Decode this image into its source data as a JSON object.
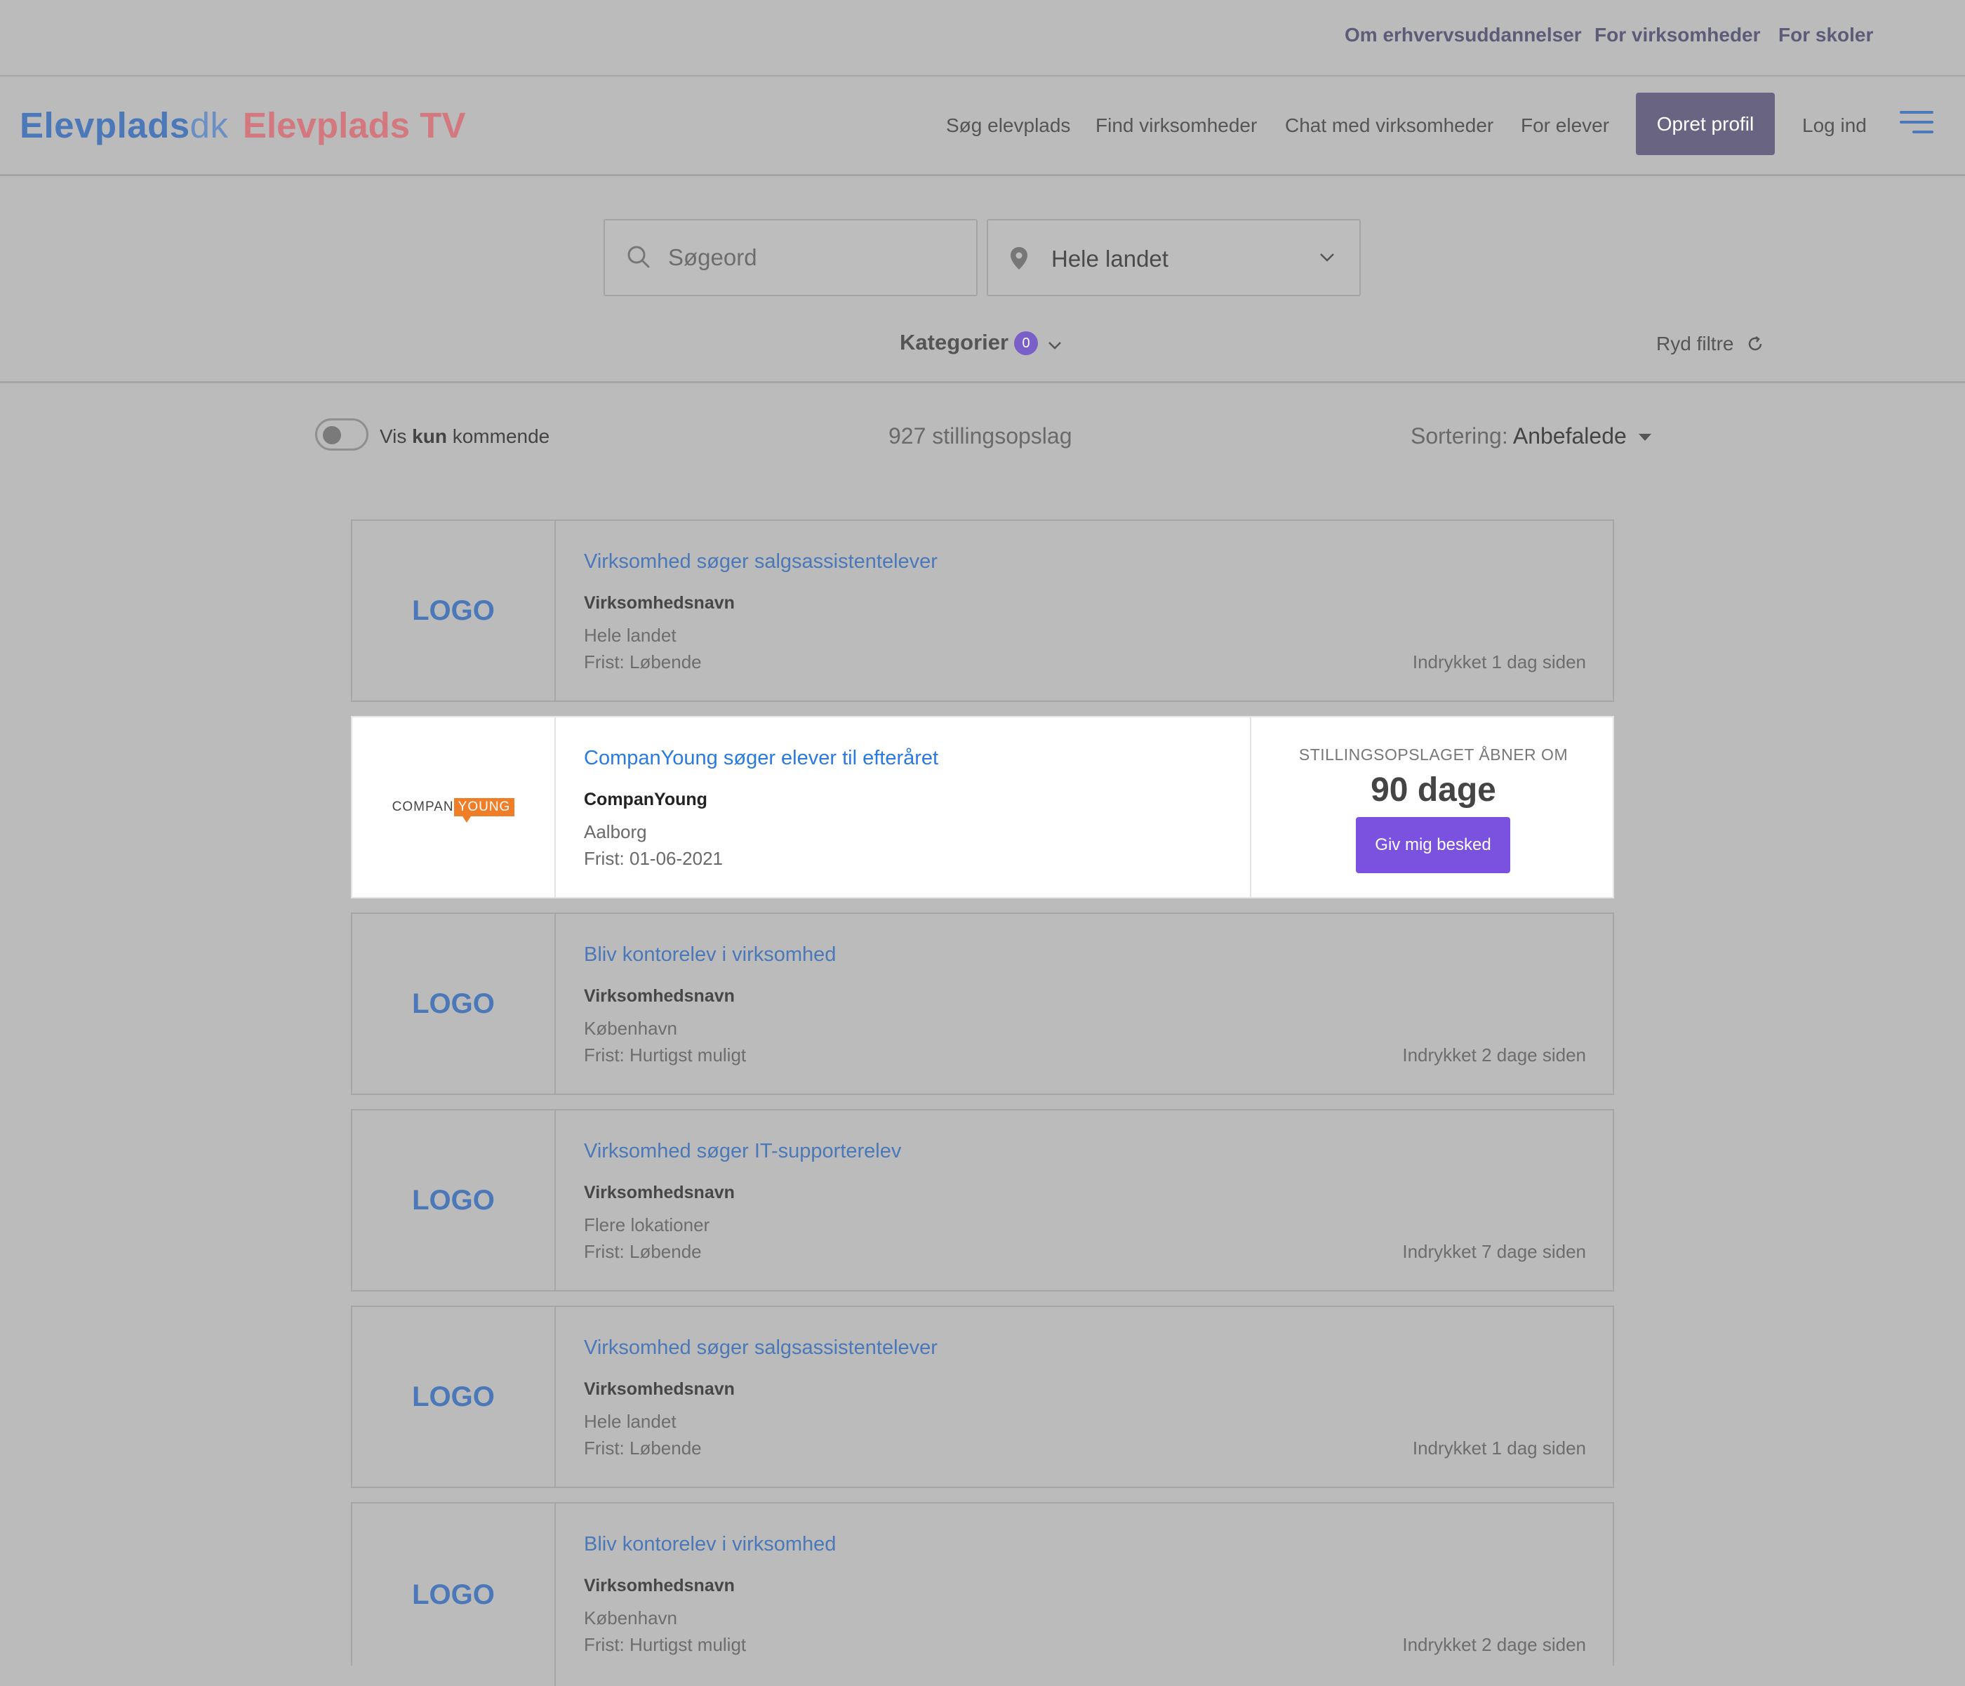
{
  "topbar": {
    "links": [
      "Om erhvervsuddannelser",
      "For virksomheder",
      "For skoler"
    ]
  },
  "header": {
    "logo": {
      "main": "Elevplads",
      "suffix": "dk"
    },
    "logo_tv": "Elevplads TV",
    "nav": [
      "Søg elevplads",
      "Find virksomheder",
      "Chat med virksomheder",
      "For elever"
    ],
    "cta": "Opret profil",
    "login": "Log ind"
  },
  "search": {
    "keyword_placeholder": "Søgeord",
    "location_value": "Hele landet"
  },
  "filters": {
    "categories_label": "Kategorier",
    "categories_count": "0",
    "clear_label": "Ryd filtre"
  },
  "toolbar": {
    "toggle_label": {
      "pre": "Vis",
      "bold": "kun",
      "post": "kommende"
    },
    "count_text": "927 stillingsopslag",
    "sort_label": "Sortering:",
    "sort_value": "Anbefalede"
  },
  "jobs": [
    {
      "logo": "LOGO",
      "title": "Virksomhed søger salgsassistentelever",
      "company": "Virksomhedsnavn",
      "location": "Hele landet",
      "deadline": "Frist: Løbende",
      "posted": "Indrykket 1 dag siden"
    },
    {
      "logo": "companyoung",
      "logo_text": [
        "COMPAN",
        "YOUNG"
      ],
      "title": "CompanYoung søger elever til efteråret",
      "company": "CompanYoung",
      "location": "Aalborg",
      "deadline": "Frist: 01-06-2021",
      "featured": {
        "opens_label": "STILLINGSOPSLAGET ÅBNER OM",
        "days": "90 dage",
        "button": "Giv mig besked"
      }
    },
    {
      "logo": "LOGO",
      "title": "Bliv kontorelev i virksomhed",
      "company": "Virksomhedsnavn",
      "location": "København",
      "deadline": "Frist: Hurtigst muligt",
      "posted": "Indrykket 2 dage siden"
    },
    {
      "logo": "LOGO",
      "title": "Virksomhed søger IT-supporterelev",
      "company": "Virksomhedsnavn",
      "location": "Flere lokationer",
      "deadline": "Frist: Løbende",
      "posted": "Indrykket 7 dage siden"
    },
    {
      "logo": "LOGO",
      "title": "Virksomhed søger salgsassistentelever",
      "company": "Virksomhedsnavn",
      "location": "Hele landet",
      "deadline": "Frist: Løbende",
      "posted": "Indrykket 1 dag siden"
    },
    {
      "logo": "LOGO",
      "title": "Bliv kontorelev i virksomhed",
      "company": "Virksomhedsnavn",
      "location": "København",
      "deadline": "Frist: Hurtigst muligt",
      "posted": "Indrykket 2 dage siden"
    }
  ],
  "colors": {
    "brand_blue": "#4a78b8",
    "tv_red": "#d2787e",
    "cta_purple": "#7b52e0",
    "link_blue": "#2a7ae2",
    "companyoung_orange": "#f07d28"
  }
}
